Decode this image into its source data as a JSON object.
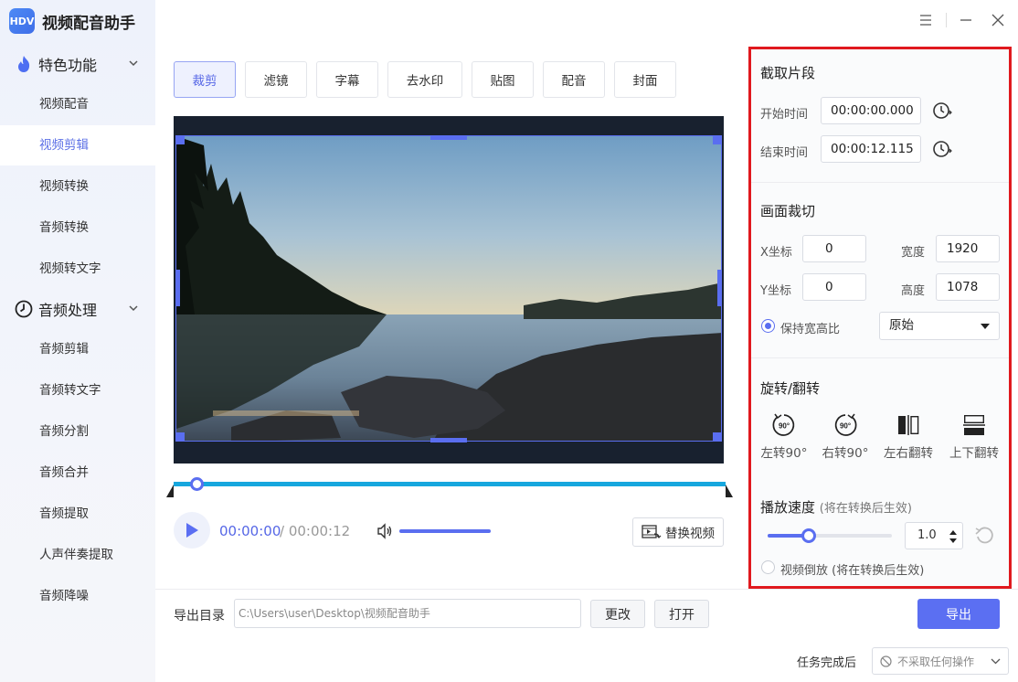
{
  "app": {
    "name": "视频配音助手",
    "logo_text": "HDV"
  },
  "sidebar": {
    "groups": [
      {
        "label": "特色功能",
        "icon": "flame-icon"
      },
      {
        "label": "音频处理",
        "icon": "clock-icon"
      }
    ],
    "items": [
      {
        "label": "视频配音",
        "active": false
      },
      {
        "label": "视频剪辑",
        "active": true
      },
      {
        "label": "视频转换",
        "active": false
      },
      {
        "label": "音频转换",
        "active": false
      },
      {
        "label": "视频转文字",
        "active": false
      },
      {
        "label": "音频剪辑",
        "active": false
      },
      {
        "label": "音频转文字",
        "active": false
      },
      {
        "label": "音频分割",
        "active": false
      },
      {
        "label": "音频合并",
        "active": false
      },
      {
        "label": "音频提取",
        "active": false
      },
      {
        "label": "人声伴奏提取",
        "active": false
      },
      {
        "label": "音频降噪",
        "active": false
      }
    ]
  },
  "tabs": [
    "裁剪",
    "滤镜",
    "字幕",
    "去水印",
    "贴图",
    "配音",
    "封面"
  ],
  "active_tab": "裁剪",
  "player": {
    "current_time": "00:00:00",
    "separator": " / ",
    "total_time": "00:00:12",
    "replace_label": "替换视频"
  },
  "export": {
    "dir_label": "导出目录",
    "path": "C:\\Users\\user\\Desktop\\视频配音助手",
    "change_label": "更改",
    "open_label": "打开",
    "export_label": "导出",
    "after_label": "任务完成后",
    "after_value": "不采取任何操作"
  },
  "panel": {
    "clip": {
      "title": "截取片段",
      "start_label": "开始时间",
      "start_value": "00:00:00.000",
      "end_label": "结束时间",
      "end_value": "00:00:12.115"
    },
    "crop": {
      "title": "画面裁切",
      "x_label": "X坐标",
      "x_value": "0",
      "y_label": "Y坐标",
      "y_value": "0",
      "width_label": "宽度",
      "width_value": "1920",
      "height_label": "高度",
      "height_value": "1078",
      "keep_ratio_label": "保持宽高比",
      "keep_ratio_checked": true,
      "ratio_value": "原始"
    },
    "rotate": {
      "title": "旋转/翻转",
      "left_label": "左转90°",
      "right_label": "右转90°",
      "hflip_label": "左右翻转",
      "vflip_label": "上下翻转",
      "badge": "90°"
    },
    "speed": {
      "title": "播放速度",
      "note": "(将在转换后生效)",
      "value": "1.0",
      "slider_fraction": 0.33,
      "reverse_label": "视频倒放",
      "reverse_note": "(将在转换后生效)",
      "reverse_checked": false
    }
  },
  "colors": {
    "accent": "#5b6ff2",
    "highlight_border": "#e0191e",
    "timeline": "#16a7de"
  }
}
